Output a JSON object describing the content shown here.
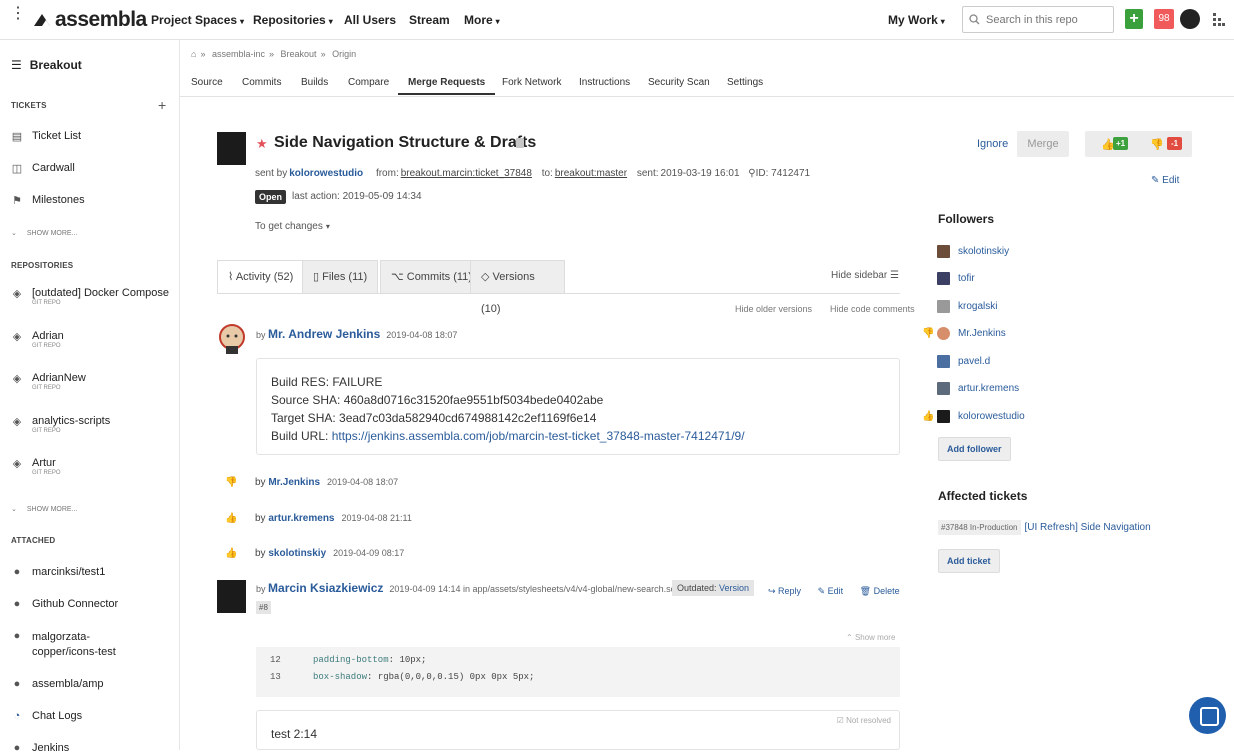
{
  "topnav": {
    "logo": "assembla",
    "items": [
      {
        "label": "Project Spaces",
        "caret": true
      },
      {
        "label": "Repositories",
        "caret": true
      },
      {
        "label": "All Users",
        "caret": false
      },
      {
        "label": "Stream",
        "caret": false
      },
      {
        "label": "More",
        "caret": true
      }
    ],
    "my_work": "My Work",
    "search_placeholder": "Search in this repo",
    "notif_count": "98",
    "plus": "+"
  },
  "sidebar": {
    "title": "Breakout",
    "tickets_header": "TICKETS",
    "ticket_items": [
      "Ticket List",
      "Cardwall",
      "Milestones"
    ],
    "show_more": "SHOW MORE...",
    "repos_header": "REPOSITORIES",
    "repos": [
      {
        "name": "[outdated] Docker Compose",
        "sub": "GIT REPO"
      },
      {
        "name": "Adrian",
        "sub": "GIT REPO"
      },
      {
        "name": "AdrianNew",
        "sub": "GIT REPO"
      },
      {
        "name": "analytics-scripts",
        "sub": "GIT REPO"
      },
      {
        "name": "Artur",
        "sub": "GIT REPO"
      }
    ],
    "attached_header": "ATTACHED",
    "attached": [
      "marcinksi/test1",
      "Github Connector",
      "malgorzata-copper/icons-test",
      "assembla/amp",
      "Chat Logs",
      "Jenkins"
    ]
  },
  "breadcrumb": [
    "assembla-inc",
    "Breakout",
    "Origin"
  ],
  "tabs": [
    "Source",
    "Commits",
    "Builds",
    "Compare",
    "Merge Requests",
    "Fork Network",
    "Instructions",
    "Security Scan",
    "Settings"
  ],
  "active_tab": "Merge Requests",
  "mr": {
    "title": "Side Navigation Structure & Drafts",
    "sent_by_label": "sent by",
    "sent_by": "kolorowestudio",
    "from_label": "from:",
    "from": "breakout.marcin:ticket_37848",
    "to_label": "to:",
    "to": "breakout:master",
    "sent_label": "sent:",
    "sent": "2019-03-19 16:01",
    "id": "ID: 7412471",
    "status": "Open",
    "last_action": "last action: 2019-05-09 14:34",
    "get_changes": "To get changes",
    "ignore": "Ignore",
    "merge": "Merge",
    "vote_up": "+1",
    "vote_down": "-1",
    "edit": "Edit"
  },
  "activity_tabs": [
    {
      "label": "Activity (52)",
      "icon": "activity-icon"
    },
    {
      "label": "Files (11)",
      "icon": "file-icon"
    },
    {
      "label": "Commits (11)",
      "icon": "commit-icon"
    },
    {
      "label": "Versions (10)",
      "icon": "versions-icon"
    }
  ],
  "hide_sidebar": "Hide sidebar",
  "hide_older": "Hide older versions",
  "hide_code": "Hide code comments",
  "comment1": {
    "by": "by",
    "author": "Mr. Andrew Jenkins",
    "time": "2019-04-08 18:07",
    "lines": [
      "Build RES: FAILURE",
      "Source SHA: 460a8d0716c31520fae9551bf5034bede0402abe",
      "Target SHA: 3ead7c03da582940cd674988142c2ef1169f6e14"
    ],
    "url_label": "Build URL: ",
    "url": "https://jenkins.assembla.com/job/marcin-test-ticket_37848-master-7412471/9/"
  },
  "votes": [
    {
      "type": "down",
      "by": "by",
      "user": "Mr.Jenkins",
      "time": "2019-04-08 18:07"
    },
    {
      "type": "up",
      "by": "by",
      "user": "artur.kremens",
      "time": "2019-04-08 21:11"
    },
    {
      "type": "up",
      "by": "by",
      "user": "skolotinskiy",
      "time": "2019-04-09 08:17"
    }
  ],
  "comment2": {
    "by": "by",
    "author": "Marcin Ksiazkiewicz",
    "meta": "2019-04-09 14:14 in app/assets/stylesheets/v4/v4-global/new-search.scss",
    "outdated": "Outdated:",
    "version": "Version",
    "num": "#8",
    "reply": "Reply",
    "edit": "Edit",
    "delete": "Delete",
    "show_more": "Show more",
    "code": [
      {
        "ln": "12",
        "prop": "padding-bottom",
        "val": "10px;"
      },
      {
        "ln": "13",
        "prop": "box-shadow",
        "val": "rgba(0,0,0,0.15) 0px 0px 5px;"
      }
    ],
    "text": "test 2:14",
    "not_resolved": "Not resolved"
  },
  "followers_title": "Followers",
  "followers": [
    {
      "name": "skolotinskiy",
      "vote": ""
    },
    {
      "name": "tofir",
      "vote": ""
    },
    {
      "name": "krogalski",
      "vote": ""
    },
    {
      "name": "Mr.Jenkins",
      "vote": "down"
    },
    {
      "name": "pavel.d",
      "vote": ""
    },
    {
      "name": "artur.kremens",
      "vote": ""
    },
    {
      "name": "kolorowestudio",
      "vote": "up"
    }
  ],
  "add_follower": "Add follower",
  "affected_title": "Affected tickets",
  "affected": {
    "tag": "#37848 In-Production",
    "link": "[UI Refresh] Side Navigation"
  },
  "add_ticket": "Add ticket",
  "colors": {
    "accent": "#2a5b9a",
    "open_badge": "#333333",
    "plus": "#39a03c",
    "notif": "#f05a5a"
  }
}
